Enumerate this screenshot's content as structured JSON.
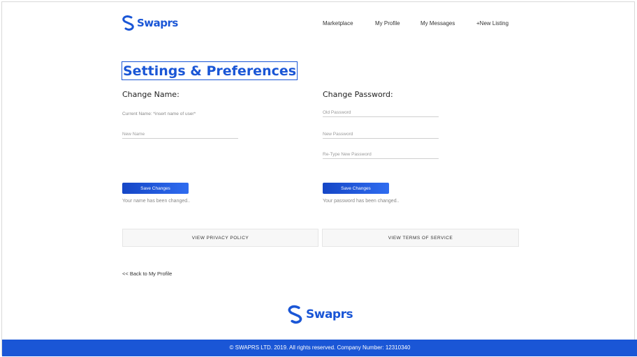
{
  "header": {
    "logo_text": "Swaprs",
    "nav": [
      "Marketplace",
      "My Profile",
      "My Messages",
      "+New Listing"
    ]
  },
  "page_title": "Settings & Preferences",
  "change_name": {
    "heading": "Change Name:",
    "current_name": "Current Name: *insert name of user*",
    "new_name_placeholder": "New Name",
    "save_label": "Save Changes",
    "status": "Your name has been changed.."
  },
  "change_password": {
    "heading": "Change Password:",
    "old_placeholder": "Old Password",
    "new_placeholder": "New Password",
    "retype_placeholder": "Re-Type New Password",
    "save_label": "Save Changes",
    "status": "Your password has been changed.."
  },
  "links": {
    "privacy": "VIEW PRIVACY POLICY",
    "terms": "VIEW TERMS OF SERVICE",
    "back": "<< Back to My Profile"
  },
  "footer": {
    "logo_text": "Swaprs",
    "copyright": "© SWAPRS LTD. 2019. All rights reserved. Company Number: 12310340"
  },
  "colors": {
    "brand": "#1a56d6"
  }
}
